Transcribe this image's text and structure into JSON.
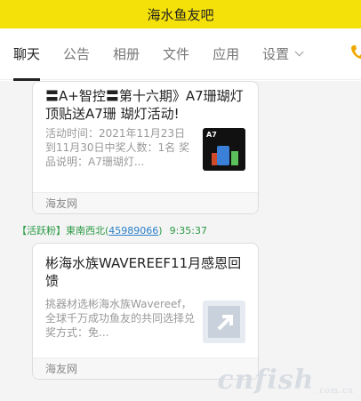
{
  "header": {
    "title": "海水鱼友吧"
  },
  "tabs": [
    {
      "label": "聊天"
    },
    {
      "label": "公告"
    },
    {
      "label": "相册"
    },
    {
      "label": "文件"
    },
    {
      "label": "应用"
    },
    {
      "label": "设置"
    }
  ],
  "cards": [
    {
      "title": "〓A+智控〓第十六期》A7珊瑚灯顶贴送A7珊 瑚灯活动!",
      "desc": "活动时间：2021年11月23日到11月30日中奖人数：1名 奖品说明：A7珊瑚灯...",
      "thumb_text": "A7",
      "source": "海友网"
    },
    {
      "title": "彬海水族WAVEREEF11月感恩回馈",
      "desc": "挑器材选彬海水族Wavereef，全球千万成功鱼友的共同选择兑奖方式：免...",
      "source": "海友网"
    }
  ],
  "message": {
    "badge": "【活跃粉】",
    "user": "東南西北",
    "id": "45989066",
    "time": "9:35:37"
  },
  "watermark": {
    "text": "cnfish",
    "suffix": ".com.cn"
  },
  "colors": {
    "topbar": "#f5e10a",
    "accent_green": "#2a9a44",
    "link_blue": "#2a7fc9"
  }
}
